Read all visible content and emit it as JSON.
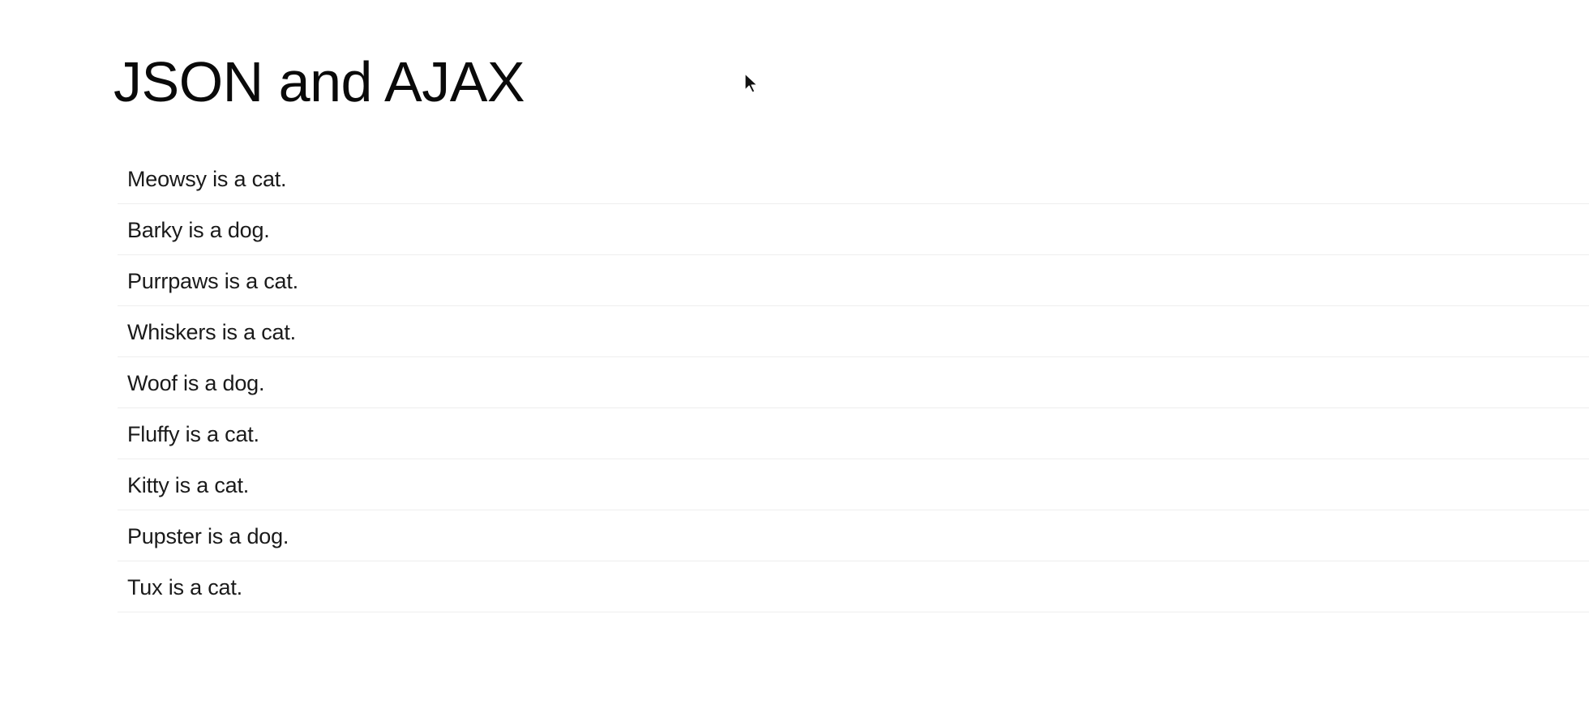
{
  "page": {
    "title": "JSON and AJAX"
  },
  "pets": [
    {
      "text": "Meowsy is a cat."
    },
    {
      "text": "Barky is a dog."
    },
    {
      "text": "Purrpaws is a cat."
    },
    {
      "text": "Whiskers is a cat."
    },
    {
      "text": "Woof is a dog."
    },
    {
      "text": "Fluffy is a cat."
    },
    {
      "text": "Kitty is a cat."
    },
    {
      "text": "Pupster is a dog."
    },
    {
      "text": "Tux is a cat."
    }
  ],
  "cursor": {
    "icon": "mouse-pointer-icon"
  }
}
